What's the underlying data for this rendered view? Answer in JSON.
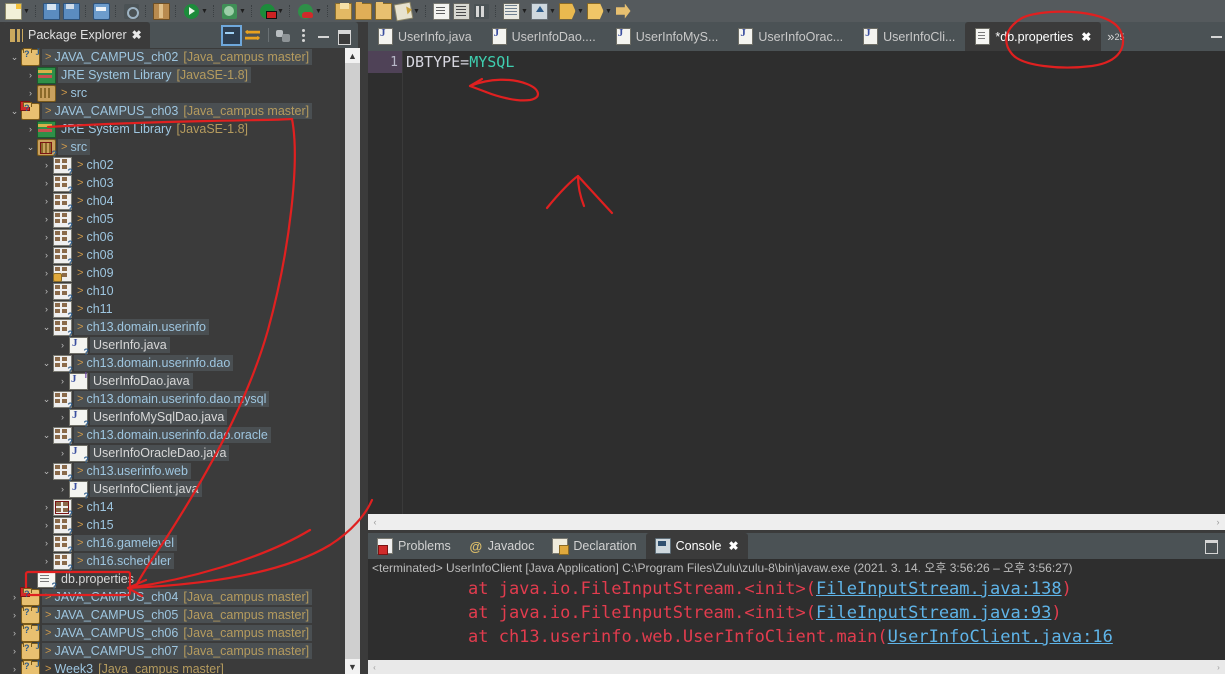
{
  "app": {
    "title": "Eclipse IDE"
  },
  "toolbar": {
    "items": [
      {
        "name": "new-icon",
        "cls": "ic-newdoc",
        "dd": true
      },
      {
        "sep": true
      },
      {
        "name": "save-icon",
        "cls": "ic-save"
      },
      {
        "name": "save-all-icon",
        "cls": "ic-saveall"
      },
      {
        "sep": true
      },
      {
        "name": "print-icon",
        "cls": "ic-print"
      },
      {
        "sep": true
      },
      {
        "name": "quick-fix-icon",
        "cls": "ic-quickfix"
      },
      {
        "sep": true
      },
      {
        "name": "new-java-package-icon",
        "cls": "ic-box"
      },
      {
        "sep": true
      },
      {
        "name": "run-icon",
        "cls": "ic-run",
        "dd": true
      },
      {
        "sep": true
      },
      {
        "name": "debug-icon",
        "cls": "ic-debug",
        "dd": true
      },
      {
        "sep": true
      },
      {
        "name": "run-last-tool-icon",
        "cls": "ic-runconf",
        "dd": true
      },
      {
        "sep": true
      },
      {
        "name": "coverage-icon",
        "cls": "ic-coverage",
        "dd": true
      },
      {
        "sep": true
      },
      {
        "name": "new-java-project-icon",
        "cls": "ic-newjava"
      },
      {
        "name": "open-type-icon",
        "cls": "ic-folder"
      },
      {
        "name": "open-resource-icon",
        "cls": "ic-folder2"
      },
      {
        "name": "edit-icon",
        "cls": "ic-pencil",
        "dd": true
      },
      {
        "sep": true
      },
      {
        "name": "new-class-icon",
        "cls": "ic-doc"
      },
      {
        "name": "outline-icon",
        "cls": "ic-doc2"
      },
      {
        "name": "toggle-breakpoint-icon",
        "cls": "ic-bars"
      },
      {
        "sep": true
      },
      {
        "name": "task-list-icon",
        "cls": "ic-tbl",
        "dd": true
      },
      {
        "name": "step-return-icon",
        "cls": "ic-up",
        "dd": true
      },
      {
        "name": "previous-annotation-icon",
        "cls": "ic-ytag",
        "dd": true
      },
      {
        "name": "next-annotation-icon",
        "cls": "ic-ytag2",
        "dd": true
      },
      {
        "name": "forward-icon",
        "cls": "ic-rarrow"
      }
    ]
  },
  "package_explorer": {
    "tab_label": "Package Explorer",
    "close_glyph": "✖",
    "tools": [
      {
        "name": "collapse-all-icon",
        "cls": "t-collapse"
      },
      {
        "name": "link-with-editor-icon",
        "cls": "t-link"
      },
      {
        "name": "toolbar-divider",
        "cls": "t-divider"
      },
      {
        "name": "view-filter-icon",
        "cls": "t-filter"
      },
      {
        "name": "view-menu-icon",
        "cls": "t-menu"
      },
      {
        "name": "minimize-icon",
        "cls": "t-min"
      },
      {
        "name": "maximize-icon",
        "cls": "t-max"
      }
    ],
    "tree": [
      {
        "indent": 0,
        "twist": "⌄",
        "icon": "i-proj i-badge-q",
        "arrow": ">",
        "label": "JAVA_CAMPUS_ch02",
        "suffix": "[Java_campus master]",
        "kind": "project",
        "sel": true
      },
      {
        "indent": 1,
        "twist": "›",
        "icon": "i-lib",
        "arrow": "",
        "label": "JRE System Library",
        "suffix": "[JavaSE-1.8]",
        "kind": "lib",
        "sel": true
      },
      {
        "indent": 1,
        "twist": "›",
        "icon": "i-src",
        "arrow": ">",
        "label": "src",
        "suffix": "",
        "kind": "src"
      },
      {
        "indent": 0,
        "twist": "⌄",
        "icon": "i-proj i-badge-err i-badge-q",
        "arrow": ">",
        "label": "JAVA_CAMPUS_ch03",
        "suffix": "[Java_campus master]",
        "kind": "project",
        "sel": true
      },
      {
        "indent": 1,
        "twist": "›",
        "icon": "i-lib",
        "arrow": "",
        "label": "JRE System Library",
        "suffix": "[JavaSE-1.8]",
        "kind": "lib"
      },
      {
        "indent": 1,
        "twist": "⌄",
        "icon": "i-src i-badge-err i-badge-q",
        "arrow": ">",
        "label": "src",
        "suffix": "",
        "kind": "src",
        "sel": true
      },
      {
        "indent": 2,
        "twist": "›",
        "icon": "i-pkg i-badge-q",
        "arrow": ">",
        "label": "ch02",
        "suffix": "",
        "kind": "pkg"
      },
      {
        "indent": 2,
        "twist": "›",
        "icon": "i-pkg i-badge-q",
        "arrow": ">",
        "label": "ch03",
        "suffix": "",
        "kind": "pkg"
      },
      {
        "indent": 2,
        "twist": "›",
        "icon": "i-pkg i-badge-q",
        "arrow": ">",
        "label": "ch04",
        "suffix": "",
        "kind": "pkg"
      },
      {
        "indent": 2,
        "twist": "›",
        "icon": "i-pkg i-badge-q",
        "arrow": ">",
        "label": "ch05",
        "suffix": "",
        "kind": "pkg"
      },
      {
        "indent": 2,
        "twist": "›",
        "icon": "i-pkg i-badge-q",
        "arrow": ">",
        "label": "ch06",
        "suffix": "",
        "kind": "pkg"
      },
      {
        "indent": 2,
        "twist": "›",
        "icon": "i-pkg i-badge-q",
        "arrow": ">",
        "label": "ch08",
        "suffix": "",
        "kind": "pkg"
      },
      {
        "indent": 2,
        "twist": "›",
        "icon": "i-pkg i-badge-q i-lock",
        "arrow": ">",
        "label": "ch09",
        "suffix": "",
        "kind": "pkg"
      },
      {
        "indent": 2,
        "twist": "›",
        "icon": "i-pkg i-badge-q",
        "arrow": ">",
        "label": "ch10",
        "suffix": "",
        "kind": "pkg"
      },
      {
        "indent": 2,
        "twist": "›",
        "icon": "i-pkg i-badge-q",
        "arrow": ">",
        "label": "ch11",
        "suffix": "",
        "kind": "pkg"
      },
      {
        "indent": 2,
        "twist": "⌄",
        "icon": "i-pkg i-badge-q",
        "arrow": ">",
        "label": "ch13.domain.userinfo",
        "suffix": "",
        "kind": "pkg",
        "sel": true
      },
      {
        "indent": 3,
        "twist": "›",
        "icon": "i-java i-badge-q",
        "arrow": "",
        "label": "UserInfo.java",
        "suffix": "",
        "kind": "file",
        "sel": true
      },
      {
        "indent": 2,
        "twist": "⌄",
        "icon": "i-pkg i-badge-q",
        "arrow": ">",
        "label": "ch13.domain.userinfo.dao",
        "suffix": "",
        "kind": "pkg",
        "sel": true
      },
      {
        "indent": 3,
        "twist": "›",
        "icon": "i-javai i-badge-q",
        "arrow": "",
        "label": "UserInfoDao.java",
        "suffix": "",
        "kind": "file",
        "sel": true
      },
      {
        "indent": 2,
        "twist": "⌄",
        "icon": "i-pkg i-badge-q",
        "arrow": ">",
        "label": "ch13.domain.userinfo.dao.mysql",
        "suffix": "",
        "kind": "pkg",
        "sel": true
      },
      {
        "indent": 3,
        "twist": "›",
        "icon": "i-java i-badge-q",
        "arrow": "",
        "label": "UserInfoMySqlDao.java",
        "suffix": "",
        "kind": "file",
        "sel": true
      },
      {
        "indent": 2,
        "twist": "⌄",
        "icon": "i-pkg i-badge-q",
        "arrow": ">",
        "label": "ch13.domain.userinfo.dao.oracle",
        "suffix": "",
        "kind": "pkg",
        "sel": true
      },
      {
        "indent": 3,
        "twist": "›",
        "icon": "i-java i-badge-q",
        "arrow": "",
        "label": "UserInfoOracleDao.java",
        "suffix": "",
        "kind": "file",
        "sel": true
      },
      {
        "indent": 2,
        "twist": "⌄",
        "icon": "i-pkg i-badge-q",
        "arrow": ">",
        "label": "ch13.userinfo.web",
        "suffix": "",
        "kind": "pkg",
        "sel": true
      },
      {
        "indent": 3,
        "twist": "›",
        "icon": "i-java i-badge-q",
        "arrow": "",
        "label": "UserInfoClient.java",
        "suffix": "",
        "kind": "file",
        "sel": true
      },
      {
        "indent": 2,
        "twist": "›",
        "icon": "i-pkg i-badge-err i-badge-q",
        "arrow": ">",
        "label": "ch14",
        "suffix": "",
        "kind": "pkg"
      },
      {
        "indent": 2,
        "twist": "›",
        "icon": "i-pkg i-badge-q",
        "arrow": ">",
        "label": "ch15",
        "suffix": "",
        "kind": "pkg"
      },
      {
        "indent": 2,
        "twist": "›",
        "icon": "i-pkg i-badge-q",
        "arrow": ">",
        "label": "ch16.gamelevel",
        "suffix": "",
        "kind": "pkg",
        "sel": true
      },
      {
        "indent": 2,
        "twist": "›",
        "icon": "i-pkg i-badge-q",
        "arrow": ">",
        "label": "ch16.scheduler",
        "suffix": "",
        "kind": "pkg",
        "sel": true
      },
      {
        "indent": 1,
        "twist": "",
        "icon": "i-file i-badge-q",
        "arrow": "",
        "label": "db.properties",
        "suffix": "",
        "kind": "file"
      },
      {
        "indent": 0,
        "twist": "›",
        "icon": "i-proj i-badge-err i-badge-q",
        "arrow": ">",
        "label": "JAVA_CAMPUS_ch04",
        "suffix": "[Java_campus master]",
        "kind": "project",
        "sel": true
      },
      {
        "indent": 0,
        "twist": "›",
        "icon": "i-proj i-badge-q",
        "arrow": ">",
        "label": "JAVA_CAMPUS_ch05",
        "suffix": "[Java_campus master]",
        "kind": "project",
        "sel": true
      },
      {
        "indent": 0,
        "twist": "›",
        "icon": "i-proj i-badge-q",
        "arrow": ">",
        "label": "JAVA_CAMPUS_ch06",
        "suffix": "[Java_campus master]",
        "kind": "project",
        "sel": true
      },
      {
        "indent": 0,
        "twist": "›",
        "icon": "i-proj i-badge-q",
        "arrow": ">",
        "label": "JAVA_CAMPUS_ch07",
        "suffix": "[Java_campus master]",
        "kind": "project",
        "sel": true
      },
      {
        "indent": 0,
        "twist": "›",
        "icon": "i-proj i-badge-q",
        "arrow": ">",
        "label": "Week3",
        "suffix": "[Java_campus master]",
        "kind": "project"
      }
    ],
    "scroll_up_glyph": "▲",
    "scroll_down_glyph": "▼"
  },
  "editor": {
    "tabs": [
      {
        "label": "UserInfo.java",
        "icon": "j",
        "active": false,
        "dirty": false
      },
      {
        "label": "UserInfoDao....",
        "icon": "j",
        "active": false,
        "dirty": false
      },
      {
        "label": "UserInfoMyS...",
        "icon": "j",
        "active": false,
        "dirty": false
      },
      {
        "label": "UserInfoOrac...",
        "icon": "j",
        "active": false,
        "dirty": false
      },
      {
        "label": "UserInfoCli...",
        "icon": "j",
        "active": false,
        "dirty": false
      },
      {
        "label": "*db.properties",
        "icon": "p",
        "active": true,
        "dirty": true
      }
    ],
    "close_glyph": "✖",
    "overflow_glyph": "»",
    "overflow_count": "25",
    "line_numbers": [
      "1"
    ],
    "code_key": "DBTYPE=",
    "code_value": "MYSQL",
    "hscroll_left_glyph": "‹",
    "hscroll_right_glyph": "›"
  },
  "console": {
    "tabs": [
      {
        "label": "Problems",
        "icon": "cico-prob",
        "active": false
      },
      {
        "label": "Javadoc",
        "icon": "cico-jdoc",
        "active": false,
        "glyph": "@"
      },
      {
        "label": "Declaration",
        "icon": "cico-decl",
        "active": false
      },
      {
        "label": "Console",
        "icon": "cico-cons",
        "active": true
      }
    ],
    "close_glyph": "✖",
    "header": "<terminated> UserInfoClient [Java Application] C:\\Program Files\\Zulu\\zulu-8\\bin\\javaw.exe  (2021. 3. 14. 오후 3:56:26 – 오후 3:56:27)",
    "stack_trace": [
      {
        "pre": "at java.io.FileInputStream.<init>(",
        "link": "FileInputStream.java:138",
        "post": ")"
      },
      {
        "pre": "at java.io.FileInputStream.<init>(",
        "link": "FileInputStream.java:93",
        "post": ")"
      },
      {
        "pre": "at ch13.userinfo.web.UserInfoClient.main(",
        "link": "UserInfoClient.java:16",
        "post": ""
      }
    ],
    "hscroll_left_glyph": "‹",
    "hscroll_right_glyph": "›"
  },
  "annotations": {
    "color": "#e02020",
    "marks": [
      "circle-around-db-properties-tab",
      "arrow-to-dbtype-line",
      "underline-java-campus-ch03",
      "long-curve-from-ch03-to-console",
      "rectangle-around-db-properties-file",
      "arrow-from-db-properties-file"
    ]
  }
}
